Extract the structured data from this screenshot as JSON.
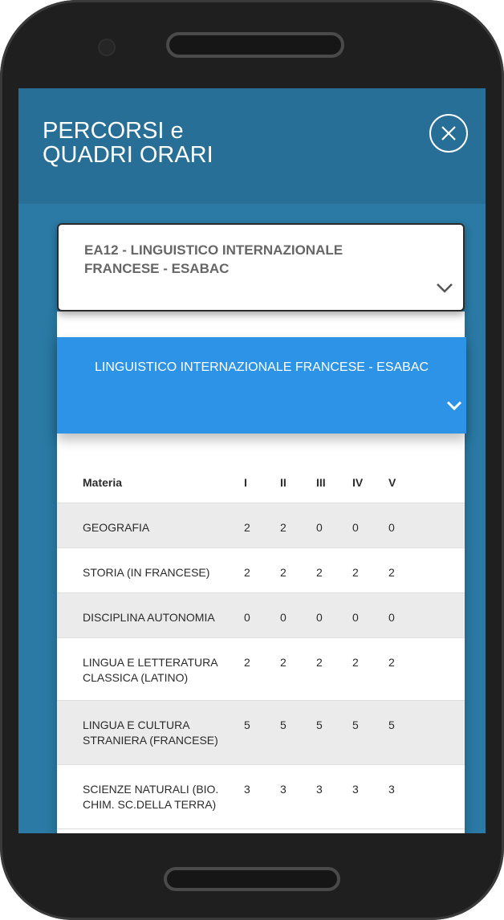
{
  "header": {
    "title": "PERCORSI e\nQUADRI ORARI"
  },
  "course_select": {
    "selected": "EA12 - LINGUISTICO INTERNAZIONALE FRANCESE - ESABAC"
  },
  "accordion": {
    "label": "LINGUISTICO INTERNAZIONALE FRANCESE - ESABAC"
  },
  "table": {
    "columns": [
      "Materia",
      "I",
      "II",
      "III",
      "IV",
      "V"
    ],
    "rows": [
      {
        "subject": "GEOGRAFIA",
        "values": [
          "2",
          "2",
          "0",
          "0",
          "0"
        ]
      },
      {
        "subject": "STORIA (IN FRANCESE)",
        "values": [
          "2",
          "2",
          "2",
          "2",
          "2"
        ]
      },
      {
        "subject": "DISCIPLINA AUTONOMIA",
        "values": [
          "0",
          "0",
          "0",
          "0",
          "0"
        ]
      },
      {
        "subject": "LINGUA E LETTERATURA CLASSICA (LATINO)",
        "values": [
          "2",
          "2",
          "2",
          "2",
          "2"
        ]
      },
      {
        "subject": "LINGUA E CULTURA STRANIERA (FRANCESE)",
        "values": [
          "5",
          "5",
          "5",
          "5",
          "5"
        ]
      },
      {
        "subject": "SCIENZE NATURALI (BIO. CHIM. SC.DELLA TERRA)",
        "values": [
          "3",
          "3",
          "3",
          "3",
          "3"
        ]
      }
    ]
  },
  "icons": {
    "close": "close-circle-icon",
    "select_chevron": "chevron-down-icon",
    "accordion_chevron": "chevron-down-icon"
  },
  "colors": {
    "screen_bg": "#2a7aa5",
    "header_bg": "#276f96",
    "accordion_bg": "#2d93e6",
    "row_alt_bg": "#ebebeb"
  }
}
